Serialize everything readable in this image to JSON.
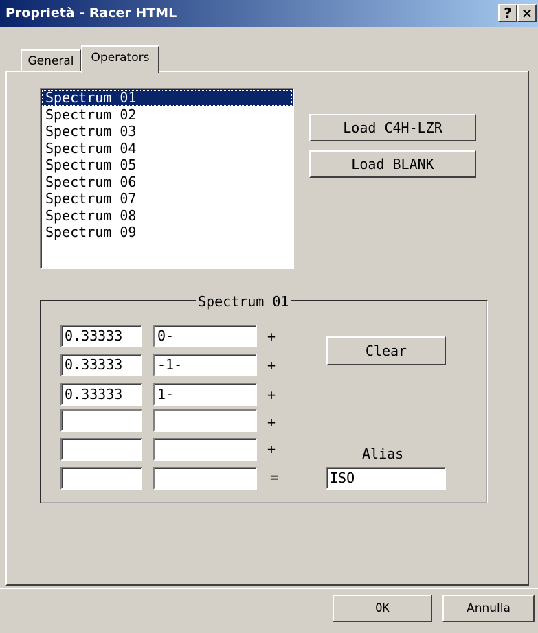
{
  "window": {
    "title": "Proprietà - Racer HTML",
    "help_label": "?",
    "close_label": "×"
  },
  "tabs": [
    {
      "label": "General",
      "active": false
    },
    {
      "label": "Operators",
      "active": true
    }
  ],
  "spectrum_list": {
    "items": [
      "Spectrum 01",
      "Spectrum 02",
      "Spectrum 03",
      "Spectrum 04",
      "Spectrum 05",
      "Spectrum 06",
      "Spectrum 07",
      "Spectrum 08",
      "Spectrum 09"
    ],
    "selected": "Spectrum 01"
  },
  "buttons": {
    "load_c4h": "Load C4H-LZR",
    "load_blank": "Load BLANK",
    "clear": "Clear",
    "ok": "OK",
    "cancel": "Annulla"
  },
  "group": {
    "title": "Spectrum 01",
    "rows": [
      {
        "coefficient": "0.33333",
        "operator": "0-",
        "sign": "+"
      },
      {
        "coefficient": "0.33333",
        "operator": "-1-",
        "sign": "+"
      },
      {
        "coefficient": "0.33333",
        "operator": "1-",
        "sign": "+"
      },
      {
        "coefficient": "",
        "operator": "",
        "sign": "+"
      },
      {
        "coefficient": "",
        "operator": "",
        "sign": "+"
      },
      {
        "coefficient": "",
        "operator": "",
        "sign": "="
      }
    ],
    "alias_label": "Alias",
    "alias_value": "ISO"
  },
  "colors": {
    "face": "#d4d0c8",
    "selection": "#0a246a",
    "title_gradient_start": "#0a246a",
    "title_gradient_end": "#a6caf0"
  }
}
